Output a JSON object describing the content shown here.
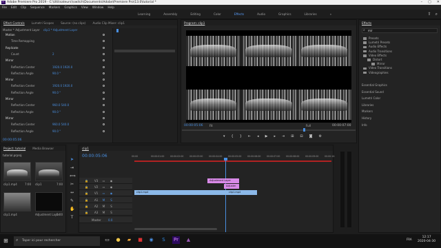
{
  "titlebar": {
    "app_icon": "Pr",
    "title": "Adobe Premiere Pro 2019 - C:\\Utilisateurs\\\\switch\\Documents\\Adobe\\Premiere Pro\\13.0\\tutorial *"
  },
  "menu": [
    "File",
    "Edit",
    "Clip",
    "Sequence",
    "Markers",
    "Graphics",
    "View",
    "Window",
    "Help"
  ],
  "workspaces": {
    "tabs": [
      "Learning",
      "Assembly",
      "Editing",
      "Color",
      "Effects",
      "Audio",
      "Graphics",
      "Libraries"
    ],
    "active": "Effects",
    "more": "»"
  },
  "effect_controls": {
    "tabs": [
      "Effect Controls",
      "Lumetri Scopes",
      "Source: (no clips)",
      "Audio Clip Mixer: clip1"
    ],
    "master": "Master * Adjustment Layer",
    "clip": "clip1 * Adjustment Layer",
    "rows": [
      {
        "label": "Motion",
        "value": "",
        "fx": true
      },
      {
        "label": "Time Remapping",
        "value": ""
      },
      {
        "label": "Replicate",
        "value": "",
        "fx": true
      },
      {
        "label": "Count",
        "value": "2"
      },
      {
        "label": "Mirror",
        "value": "",
        "fx": true
      },
      {
        "label": "Reflection Center",
        "value": "1920.0   1920.0"
      },
      {
        "label": "Reflection Angle",
        "value": "90.0 °"
      },
      {
        "label": "Mirror",
        "value": "",
        "fx": true
      },
      {
        "label": "Reflection Center",
        "value": "1920.0   1920.0"
      },
      {
        "label": "Reflection Angle",
        "value": "90.0 °"
      },
      {
        "label": "Mirror",
        "value": "",
        "fx": true
      },
      {
        "label": "Reflection Center",
        "value": "960.0   540.0"
      },
      {
        "label": "Reflection Angle",
        "value": "90.0 °"
      },
      {
        "label": "Mirror",
        "value": "",
        "fx": true
      },
      {
        "label": "Reflection Center",
        "value": "960.0   540.0"
      },
      {
        "label": "Reflection Angle",
        "value": "90.0 °"
      }
    ],
    "timecode": "00:00:05:06"
  },
  "program": {
    "title": "Program: clip1",
    "timecode": "00:00:05:06",
    "fit": "Fit",
    "quality": "Full",
    "duration": "00:00:07:00"
  },
  "effects": {
    "title": "Effects",
    "search": "mir",
    "tree": [
      {
        "label": "Presets",
        "depth": 0
      },
      {
        "label": "Lumetri Presets",
        "depth": 0
      },
      {
        "label": "Audio Effects",
        "depth": 0
      },
      {
        "label": "Audio Transitions",
        "depth": 0
      },
      {
        "label": "Video Effects",
        "depth": 0
      },
      {
        "label": "Distort",
        "depth": 1
      },
      {
        "label": "Mirror",
        "depth": 2
      },
      {
        "label": "Video Transitions",
        "depth": 0
      },
      {
        "label": "Videographies",
        "depth": 0
      }
    ],
    "panels": [
      "Essential Graphics",
      "Essential Sound",
      "Lumetri Color",
      "Libraries",
      "Markers",
      "History",
      "Info"
    ]
  },
  "project": {
    "tabs": [
      "Project: tutorial",
      "Media Browser"
    ],
    "name": "tutorial.prproj",
    "items": [
      {
        "label": "clip1.mp4",
        "dur": "7:00"
      },
      {
        "label": "clip1",
        "dur": "7:00"
      },
      {
        "label": "clip1.mp4",
        "dur": ""
      },
      {
        "label": "Adjustment Layer",
        "dur": "5:00"
      }
    ]
  },
  "timeline": {
    "tab": "clip1",
    "timecode": "00:00:05:06",
    "ruler": [
      "00:00",
      "00:00:01:00",
      "00:00:02:00",
      "00:00:03:00",
      "00:00:04:00",
      "00:00:05:00",
      "00:00:06:00",
      "00:00:07:00",
      "00:00:08:00",
      "00:00:09:00",
      "00:00:10:00"
    ],
    "tracks": [
      "V3",
      "V2",
      "V1",
      "A1",
      "A2",
      "A3"
    ],
    "master": "Master",
    "master_val": "0.0",
    "clips": [
      "Adjustment Layer",
      "Adjustm",
      "clip1.mp4",
      "clip1.mp4"
    ]
  },
  "taskbar": {
    "search": "Taper ici pour rechercher",
    "lang": "FRA",
    "time": "12:17",
    "date": "2020-04-30"
  }
}
